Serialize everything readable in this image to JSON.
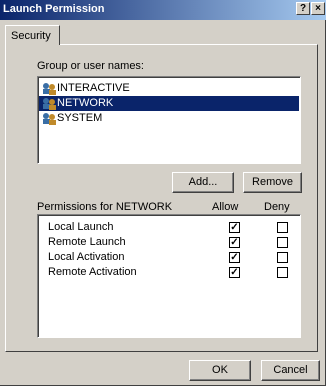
{
  "window": {
    "title": "Launch Permission",
    "help_button": "?",
    "close_button": "×"
  },
  "tabs": [
    {
      "label": "Security"
    }
  ],
  "group_section": {
    "label": "Group or user names:",
    "users": [
      {
        "name": "INTERACTIVE",
        "icon": "users-icon",
        "selected": false
      },
      {
        "name": "NETWORK",
        "icon": "users-icon",
        "selected": true
      },
      {
        "name": "SYSTEM",
        "icon": "users-icon",
        "selected": false
      }
    ]
  },
  "buttons": {
    "add": "Add...",
    "remove": "Remove",
    "ok": "OK",
    "cancel": "Cancel"
  },
  "permissions": {
    "label": "Permissions for NETWORK",
    "allow_header": "Allow",
    "deny_header": "Deny",
    "rows": [
      {
        "name": "Local Launch",
        "allow": true,
        "deny": false
      },
      {
        "name": "Remote Launch",
        "allow": true,
        "deny": false
      },
      {
        "name": "Local Activation",
        "allow": true,
        "deny": false
      },
      {
        "name": "Remote Activation",
        "allow": true,
        "deny": false
      }
    ]
  },
  "colors": {
    "title_bar": "#0a246a",
    "face": "#d4d0c8",
    "selection": "#0a246a"
  }
}
